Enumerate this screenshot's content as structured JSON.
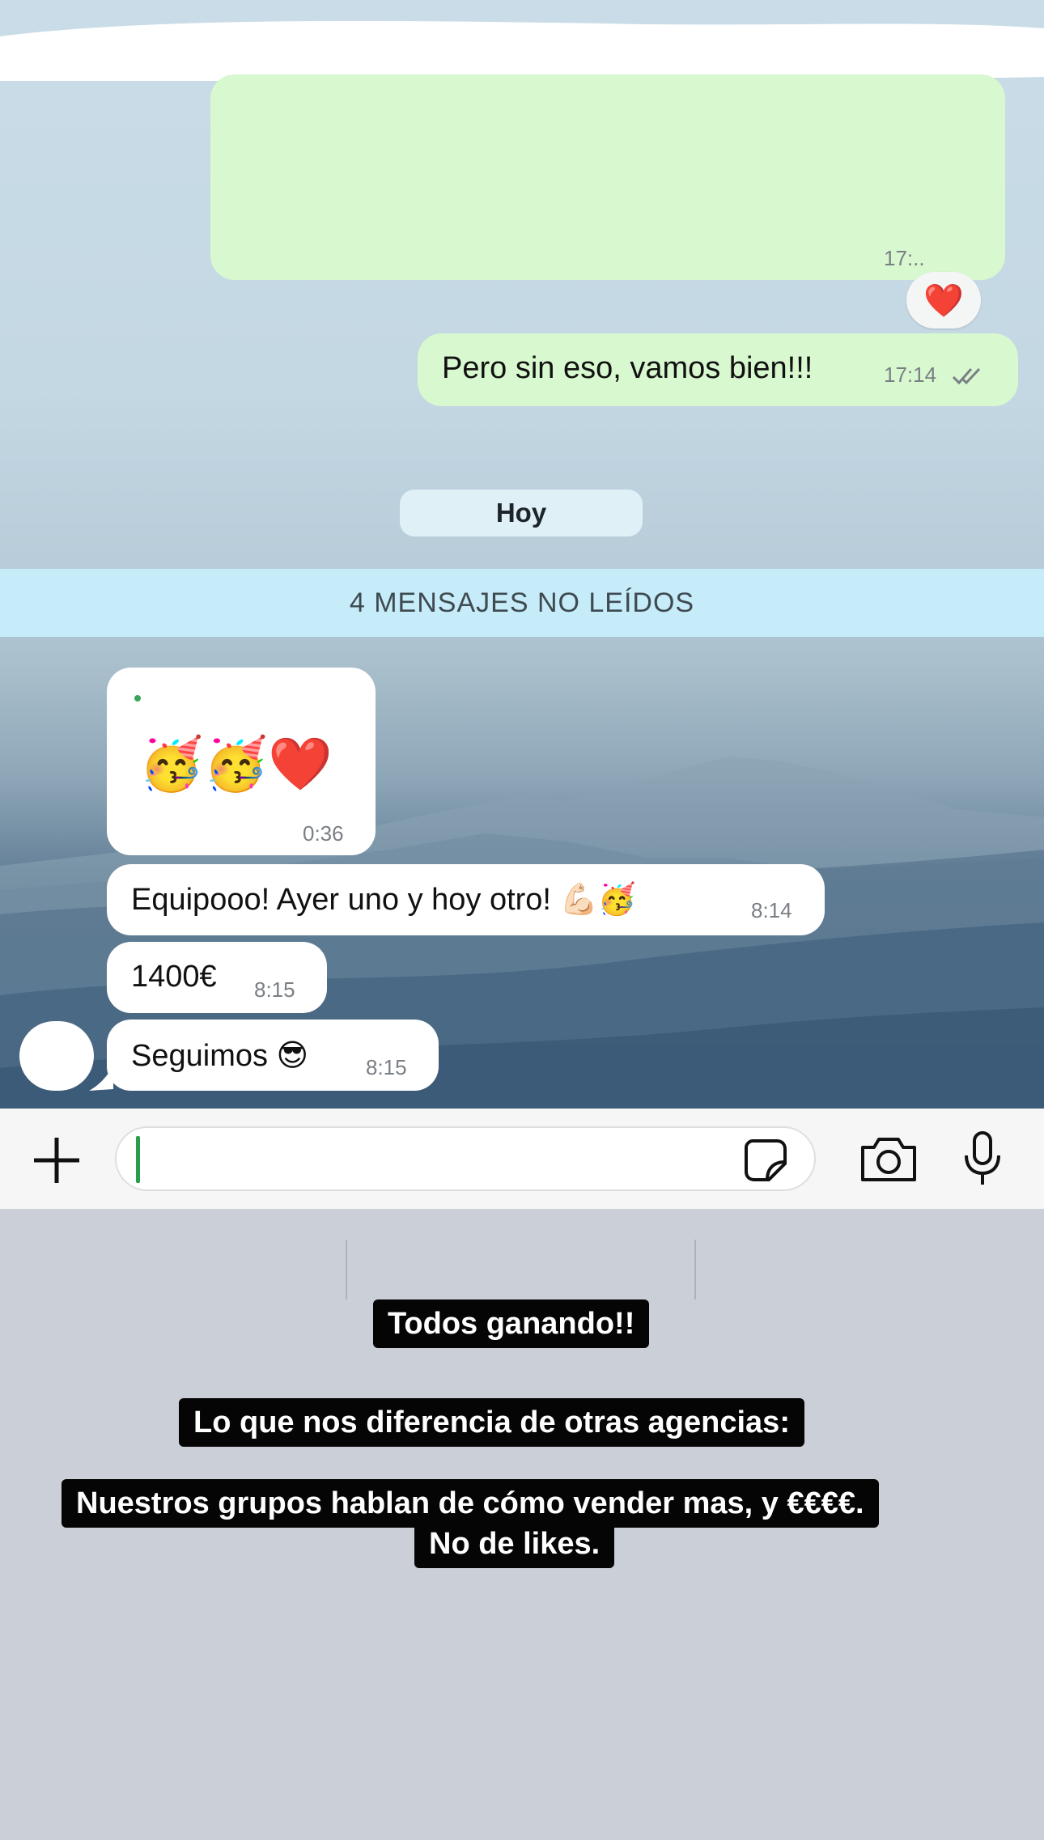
{
  "colors": {
    "outgoing_bubble": "#d8f8cf",
    "incoming_bubble": "#ffffff",
    "unread_bar": "#c6ecfa",
    "caption_bg": "#050505",
    "caret": "#2a9d4d"
  },
  "messages_out": [
    {
      "id": "redacted",
      "text": "",
      "time": "17:.."
    },
    {
      "id": "pero",
      "text": "Pero sin eso, vamos bien!!!",
      "time": "17:14",
      "status_icon": "double-check-icon"
    }
  ],
  "reaction": {
    "emoji": "❤️"
  },
  "date_chip": "Hoy",
  "unread_bar": "4 MENSAJES NO LEÍDOS",
  "messages_in": [
    {
      "text": "🥳🥳❤️",
      "time": "0:36"
    },
    {
      "text": "Equipooo! Ayer uno y hoy otro! 💪🏻🥳",
      "time": "8:14"
    },
    {
      "text": "1400€",
      "time": "8:15"
    },
    {
      "text": "Seguimos 😎",
      "time": "8:15"
    }
  ],
  "composer": {
    "icons": [
      "plus-icon",
      "sticker-icon",
      "camera-icon",
      "microphone-icon"
    ],
    "value": ""
  },
  "captions": [
    "Todos ganando!!",
    "Lo que nos diferencia de otras agencias:",
    "Nuestros grupos hablan de cómo vender mas, y €€€€.",
    "No de likes."
  ]
}
